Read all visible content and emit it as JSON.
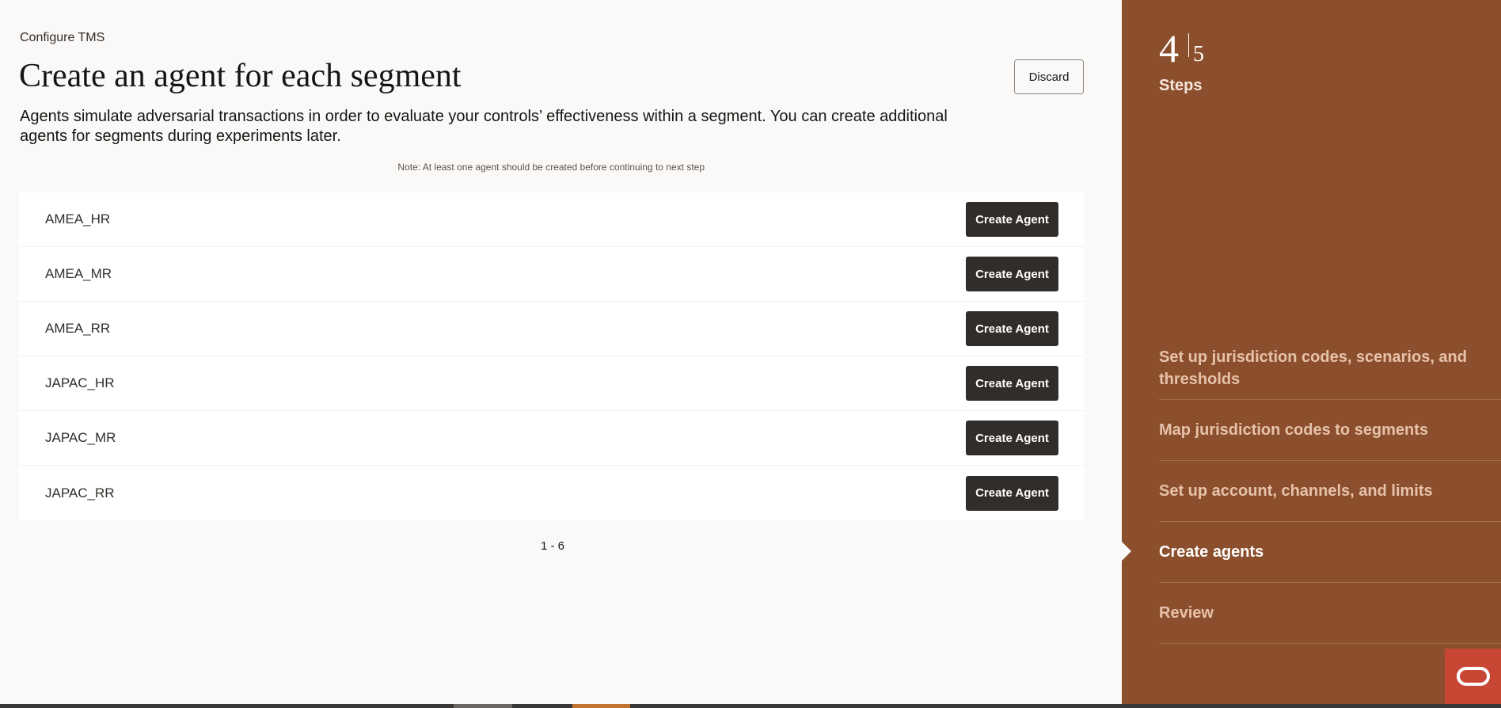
{
  "breadcrumb": "Configure TMS",
  "title": "Create an agent for each segment",
  "discard_label": "Discard",
  "description": "Agents simulate adversarial transactions in order to evaluate your controls’ effectiveness within a segment. You can create additional agents for segments during experiments later.",
  "note": "Note: At least one agent should be created before continuing to next step",
  "segments": [
    {
      "name": "AMEA_HR",
      "button": "Create Agent"
    },
    {
      "name": "AMEA_MR",
      "button": "Create Agent"
    },
    {
      "name": "AMEA_RR",
      "button": "Create Agent"
    },
    {
      "name": "JAPAC_HR",
      "button": "Create Agent"
    },
    {
      "name": "JAPAC_MR",
      "button": "Create Agent"
    },
    {
      "name": "JAPAC_RR",
      "button": "Create Agent"
    }
  ],
  "pagination": "1 - 6",
  "stepper": {
    "current": "4",
    "total": "5",
    "label": "Steps",
    "steps": [
      {
        "label": "Set up jurisdiction codes, scenarios, and thresholds",
        "active": false
      },
      {
        "label": "Map jurisdiction codes to segments",
        "active": false
      },
      {
        "label": "Set up account, channels, and limits",
        "active": false
      },
      {
        "label": "Create agents",
        "active": true
      },
      {
        "label": "Review",
        "active": false
      }
    ]
  },
  "colors": {
    "side_panel": "#8c4f2d",
    "primary_button": "#312d2a",
    "help_button": "#c74634"
  },
  "icons": {
    "help": "oracle-logo-icon"
  }
}
